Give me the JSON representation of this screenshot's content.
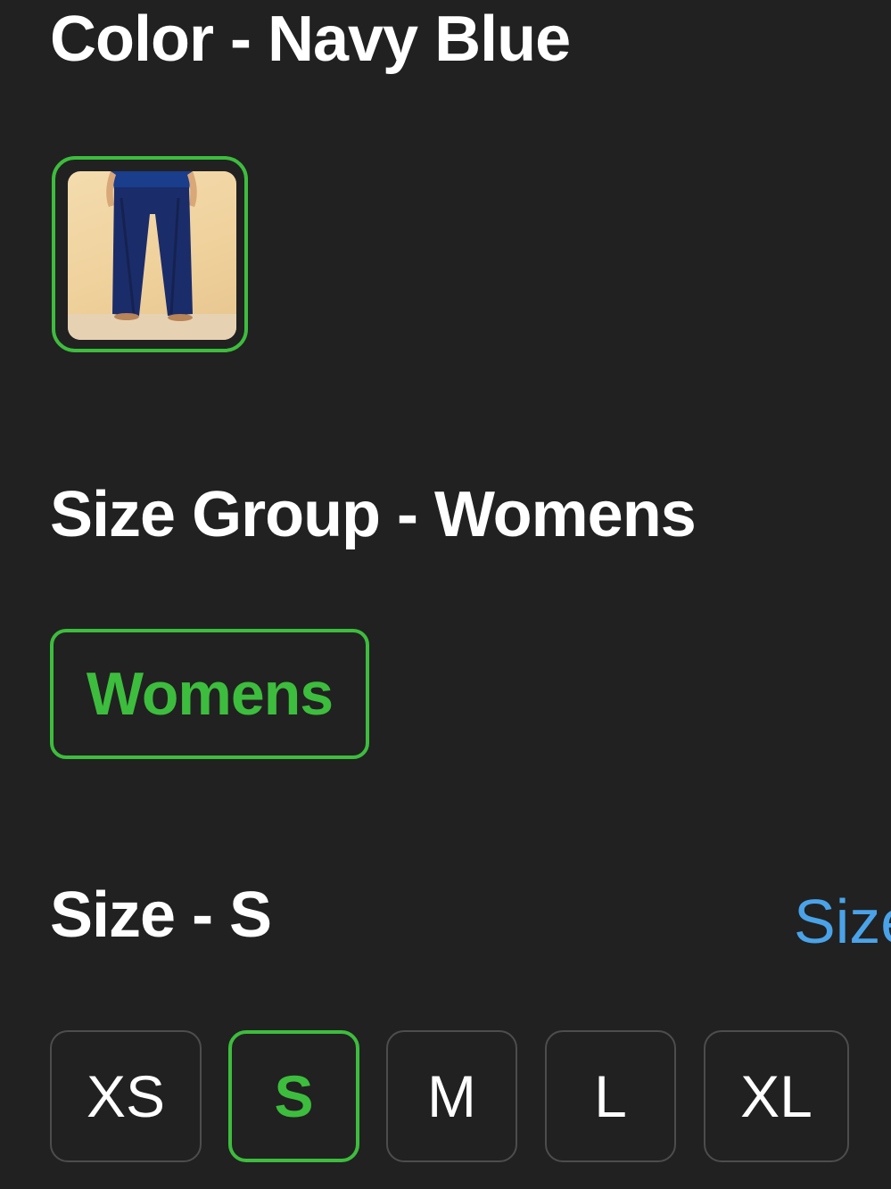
{
  "color_section": {
    "heading": "Color - Navy Blue",
    "swatches": [
      {
        "name": "Navy Blue",
        "selected": true
      }
    ]
  },
  "size_group_section": {
    "heading": "Size Group - Womens",
    "options": [
      {
        "label": "Womens",
        "selected": true
      }
    ]
  },
  "size_section": {
    "heading": "Size - S",
    "size_guide_link": "Size",
    "options": [
      {
        "label": "XS",
        "selected": false
      },
      {
        "label": "S",
        "selected": true
      },
      {
        "label": "M",
        "selected": false
      },
      {
        "label": "L",
        "selected": false
      },
      {
        "label": "XL",
        "selected": false
      }
    ]
  },
  "colors": {
    "background": "#212121",
    "text": "#ffffff",
    "selected_accent": "#3dbd3d",
    "link": "#4aa3e8",
    "unselected_border": "#4d4d4d"
  }
}
